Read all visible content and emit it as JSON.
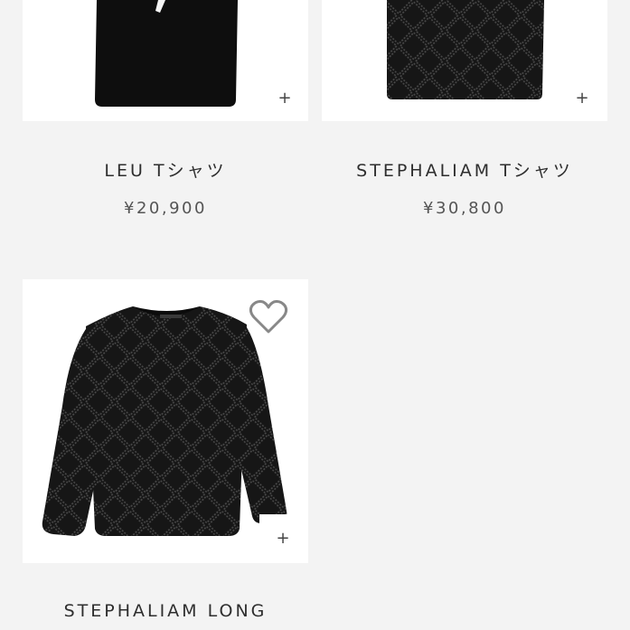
{
  "products": [
    {
      "name": "LEU Tシャツ",
      "price": "¥20,900",
      "add_icon": "plus-icon"
    },
    {
      "name": "STEPHALIAM Tシャツ",
      "price": "¥30,800",
      "add_icon": "plus-icon"
    },
    {
      "name": "STEPHALIAM LONG",
      "price": "",
      "add_icon": "plus-icon",
      "favorite_icon": "heart-outline-icon"
    }
  ]
}
